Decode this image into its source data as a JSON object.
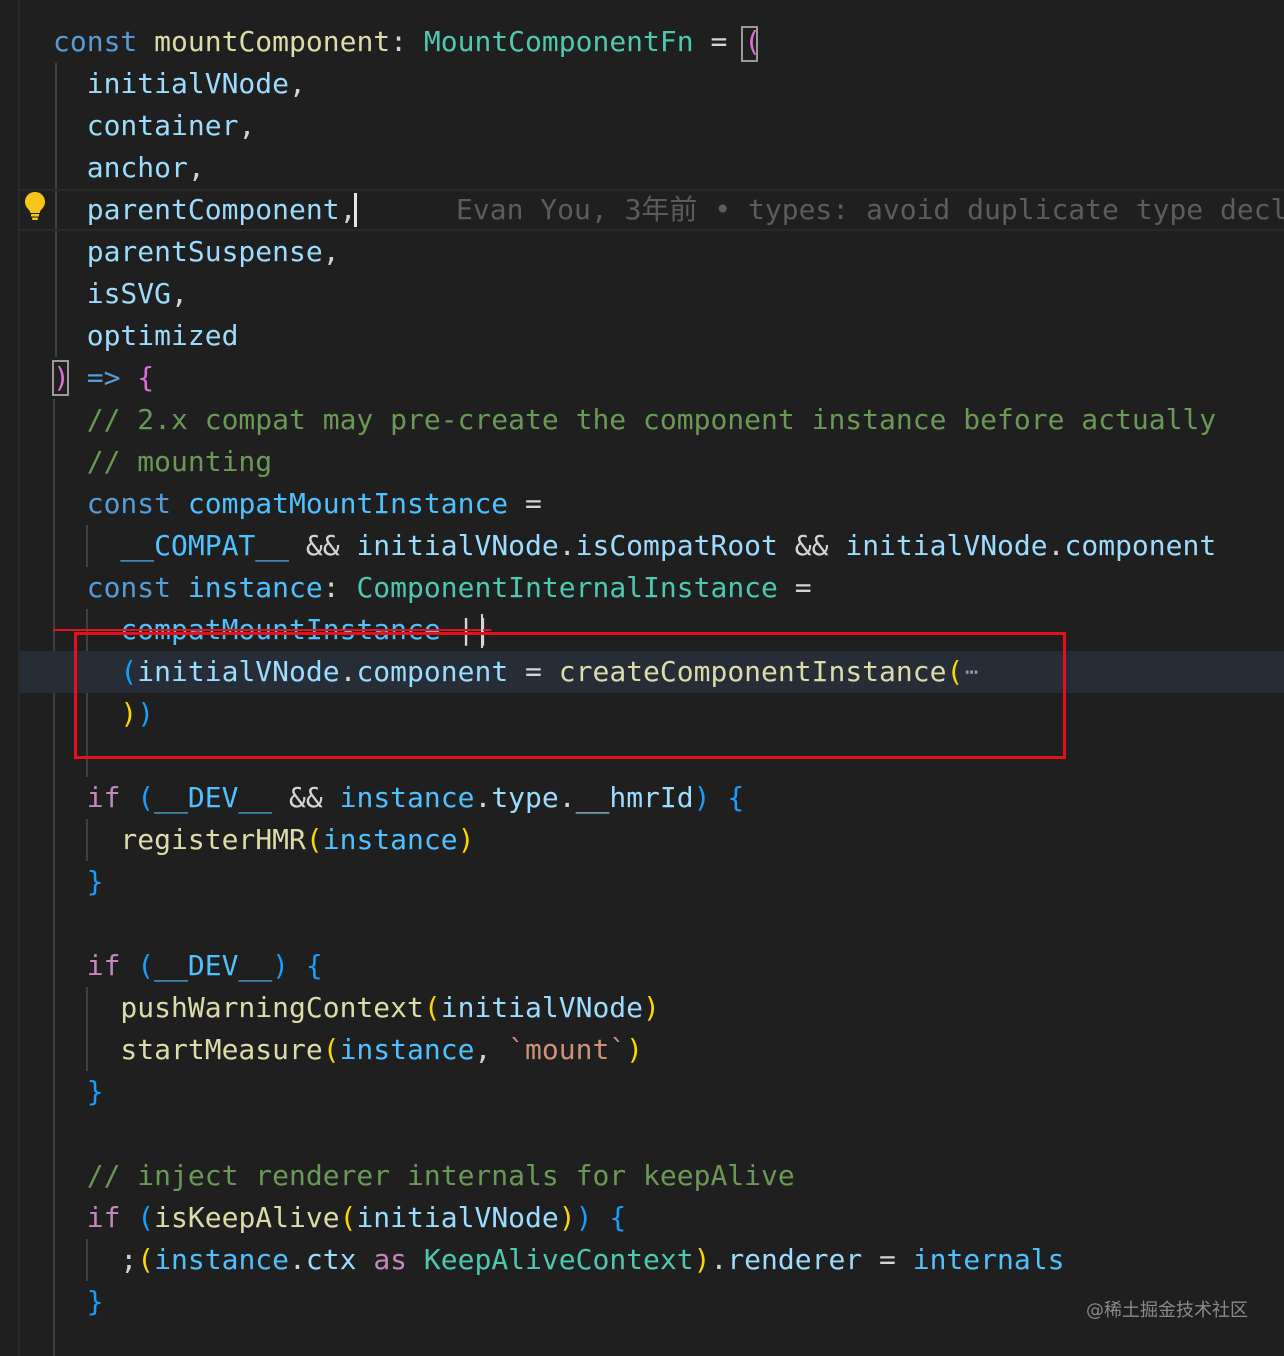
{
  "colors": {
    "background": "#1f1f1f",
    "keyword": "#569cd6",
    "control": "#c586c0",
    "variable": "#9cdcfe",
    "constant": "#4fc1ff",
    "function": "#dcdcaa",
    "type": "#4ec9b0",
    "comment": "#6a9955",
    "string": "#ce9178",
    "bracket_gold": "#ffd700",
    "bracket_purple": "#da70d6",
    "bracket_blue": "#179fff",
    "highlight_box": "#e3121a"
  },
  "blame": "Evan You, 3年前 • types: avoid duplicate type decl",
  "fold_placeholder": "⋯",
  "watermark": "@稀土掘金技术社区",
  "icons": {
    "lightbulb": "lightbulb-icon"
  },
  "lines": [
    [
      {
        "t": "const",
        "c": "#569cd6"
      },
      {
        "t": " mountComponent",
        "c": "#dcdcaa"
      },
      {
        "t": ": ",
        "c": "#d4d4d4"
      },
      {
        "t": "MountComponentFn",
        "c": "#4ec9b0"
      },
      {
        "t": " = ",
        "c": "#d4d4d4"
      },
      {
        "t": "(",
        "c": "#da70d6"
      }
    ],
    [
      {
        "t": "  initialVNode",
        "c": "#9cdcfe"
      },
      {
        "t": ",",
        "c": "#d4d4d4"
      }
    ],
    [
      {
        "t": "  container",
        "c": "#9cdcfe"
      },
      {
        "t": ",",
        "c": "#d4d4d4"
      }
    ],
    [
      {
        "t": "  anchor",
        "c": "#9cdcfe"
      },
      {
        "t": ",",
        "c": "#d4d4d4"
      }
    ],
    [
      {
        "t": "  parentComponent",
        "c": "#9cdcfe"
      },
      {
        "t": ",",
        "c": "#d4d4d4"
      }
    ],
    [
      {
        "t": "  parentSuspense",
        "c": "#9cdcfe"
      },
      {
        "t": ",",
        "c": "#d4d4d4"
      }
    ],
    [
      {
        "t": "  isSVG",
        "c": "#9cdcfe"
      },
      {
        "t": ",",
        "c": "#d4d4d4"
      }
    ],
    [
      {
        "t": "  optimized",
        "c": "#9cdcfe"
      }
    ],
    [
      {
        "t": ")",
        "c": "#da70d6"
      },
      {
        "t": " ",
        "c": "#d4d4d4"
      },
      {
        "t": "=>",
        "c": "#569cd6"
      },
      {
        "t": " ",
        "c": "#d4d4d4"
      },
      {
        "t": "{",
        "c": "#da70d6"
      }
    ],
    [
      {
        "t": "  // 2.x compat may pre-create the component instance before actually",
        "c": "#6a9955"
      }
    ],
    [
      {
        "t": "  // mounting",
        "c": "#6a9955"
      }
    ],
    [
      {
        "t": "  const",
        "c": "#569cd6"
      },
      {
        "t": " compatMountInstance",
        "c": "#4fc1ff"
      },
      {
        "t": " =",
        "c": "#d4d4d4"
      }
    ],
    [
      {
        "t": "    __COMPAT__",
        "c": "#4fc1ff"
      },
      {
        "t": " && ",
        "c": "#d4d4d4"
      },
      {
        "t": "initialVNode",
        "c": "#9cdcfe"
      },
      {
        "t": ".",
        "c": "#d4d4d4"
      },
      {
        "t": "isCompatRoot",
        "c": "#9cdcfe"
      },
      {
        "t": " && ",
        "c": "#d4d4d4"
      },
      {
        "t": "initialVNode",
        "c": "#9cdcfe"
      },
      {
        "t": ".",
        "c": "#d4d4d4"
      },
      {
        "t": "component",
        "c": "#9cdcfe"
      }
    ],
    [
      {
        "t": "  const",
        "c": "#569cd6"
      },
      {
        "t": " instance",
        "c": "#4fc1ff"
      },
      {
        "t": ": ",
        "c": "#d4d4d4"
      },
      {
        "t": "ComponentInternalInstance",
        "c": "#4ec9b0"
      },
      {
        "t": " =",
        "c": "#d4d4d4"
      }
    ],
    [
      {
        "t": "    compatMountInstance",
        "c": "#4fc1ff",
        "s": 1
      },
      {
        "t": " ||",
        "c": "#d4d4d4",
        "s": 1
      }
    ],
    [
      {
        "t": "    (",
        "c": "#179fff"
      },
      {
        "t": "initialVNode",
        "c": "#9cdcfe"
      },
      {
        "t": ".",
        "c": "#d4d4d4"
      },
      {
        "t": "component",
        "c": "#9cdcfe"
      },
      {
        "t": " = ",
        "c": "#d4d4d4"
      },
      {
        "t": "createComponentInstance",
        "c": "#dcdcaa"
      },
      {
        "t": "(",
        "c": "#ffd700"
      }
    ],
    [
      {
        "t": "    )",
        "c": "#ffd700"
      },
      {
        "t": ")",
        "c": "#179fff"
      }
    ],
    [],
    [
      {
        "t": "  if",
        "c": "#c586c0"
      },
      {
        "t": " ",
        "c": "#d4d4d4"
      },
      {
        "t": "(",
        "c": "#179fff"
      },
      {
        "t": "__DEV__",
        "c": "#4fc1ff"
      },
      {
        "t": " && ",
        "c": "#d4d4d4"
      },
      {
        "t": "instance",
        "c": "#4fc1ff"
      },
      {
        "t": ".",
        "c": "#d4d4d4"
      },
      {
        "t": "type",
        "c": "#9cdcfe"
      },
      {
        "t": ".",
        "c": "#d4d4d4"
      },
      {
        "t": "__hmrId",
        "c": "#9cdcfe"
      },
      {
        "t": ")",
        "c": "#179fff"
      },
      {
        "t": " ",
        "c": "#d4d4d4"
      },
      {
        "t": "{",
        "c": "#179fff"
      }
    ],
    [
      {
        "t": "    registerHMR",
        "c": "#dcdcaa"
      },
      {
        "t": "(",
        "c": "#ffd700"
      },
      {
        "t": "instance",
        "c": "#4fc1ff"
      },
      {
        "t": ")",
        "c": "#ffd700"
      }
    ],
    [
      {
        "t": "  }",
        "c": "#179fff"
      }
    ],
    [],
    [
      {
        "t": "  if",
        "c": "#c586c0"
      },
      {
        "t": " ",
        "c": "#d4d4d4"
      },
      {
        "t": "(",
        "c": "#179fff"
      },
      {
        "t": "__DEV__",
        "c": "#4fc1ff"
      },
      {
        "t": ")",
        "c": "#179fff"
      },
      {
        "t": " ",
        "c": "#d4d4d4"
      },
      {
        "t": "{",
        "c": "#179fff"
      }
    ],
    [
      {
        "t": "    pushWarningContext",
        "c": "#dcdcaa"
      },
      {
        "t": "(",
        "c": "#ffd700"
      },
      {
        "t": "initialVNode",
        "c": "#9cdcfe"
      },
      {
        "t": ")",
        "c": "#ffd700"
      }
    ],
    [
      {
        "t": "    startMeasure",
        "c": "#dcdcaa"
      },
      {
        "t": "(",
        "c": "#ffd700"
      },
      {
        "t": "instance",
        "c": "#4fc1ff"
      },
      {
        "t": ", ",
        "c": "#d4d4d4"
      },
      {
        "t": "`mount`",
        "c": "#ce9178"
      },
      {
        "t": ")",
        "c": "#ffd700"
      }
    ],
    [
      {
        "t": "  }",
        "c": "#179fff"
      }
    ],
    [],
    [
      {
        "t": "  // inject renderer internals for keepAlive",
        "c": "#6a9955"
      }
    ],
    [
      {
        "t": "  if",
        "c": "#c586c0"
      },
      {
        "t": " ",
        "c": "#d4d4d4"
      },
      {
        "t": "(",
        "c": "#179fff"
      },
      {
        "t": "isKeepAlive",
        "c": "#dcdcaa"
      },
      {
        "t": "(",
        "c": "#ffd700"
      },
      {
        "t": "initialVNode",
        "c": "#9cdcfe"
      },
      {
        "t": ")",
        "c": "#ffd700"
      },
      {
        "t": ")",
        "c": "#179fff"
      },
      {
        "t": " ",
        "c": "#d4d4d4"
      },
      {
        "t": "{",
        "c": "#179fff"
      }
    ],
    [
      {
        "t": "    ;",
        "c": "#d4d4d4"
      },
      {
        "t": "(",
        "c": "#ffd700"
      },
      {
        "t": "instance",
        "c": "#4fc1ff"
      },
      {
        "t": ".",
        "c": "#d4d4d4"
      },
      {
        "t": "ctx",
        "c": "#9cdcfe"
      },
      {
        "t": " ",
        "c": "#d4d4d4"
      },
      {
        "t": "as",
        "c": "#c586c0"
      },
      {
        "t": " ",
        "c": "#d4d4d4"
      },
      {
        "t": "KeepAliveContext",
        "c": "#4ec9b0"
      },
      {
        "t": ")",
        "c": "#ffd700"
      },
      {
        "t": ".",
        "c": "#d4d4d4"
      },
      {
        "t": "renderer",
        "c": "#9cdcfe"
      },
      {
        "t": " = ",
        "c": "#d4d4d4"
      },
      {
        "t": "internals",
        "c": "#4fc1ff"
      }
    ],
    [
      {
        "t": "  }",
        "c": "#179fff"
      }
    ]
  ]
}
